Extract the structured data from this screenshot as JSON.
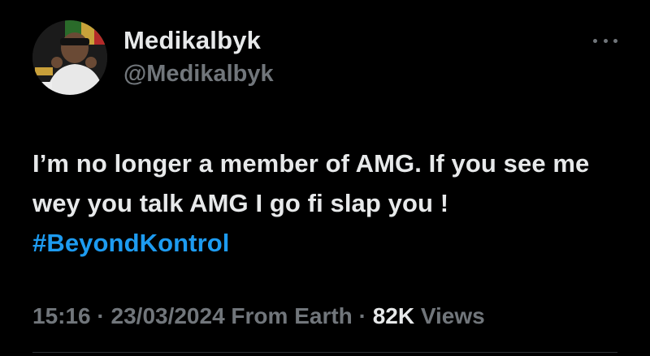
{
  "user": {
    "display_name": "Medikalbyk",
    "handle": "@Medikalbyk",
    "avatar_icon": "profile-photo"
  },
  "more_menu_icon": "ellipsis-icon",
  "tweet": {
    "text_part1": "I’m no longer a member of AMG. If you see me wey you talk AMG I go fi slap you ! ",
    "hashtag": "#BeyondKontrol"
  },
  "meta": {
    "time": "15:16",
    "separator": " · ",
    "date": "23/03/2024",
    "source": " From Earth",
    "views_count": "82K",
    "views_label": " Views"
  },
  "colors": {
    "background": "#000000",
    "primary_text": "#e7e9ea",
    "secondary_text": "#71767b",
    "link": "#1d9bf0"
  }
}
